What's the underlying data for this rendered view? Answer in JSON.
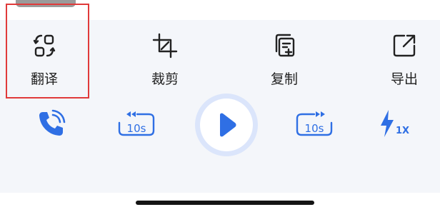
{
  "toolbar": {
    "items": [
      {
        "label": "翻译",
        "icon": "translate-icon",
        "selected": true
      },
      {
        "label": "裁剪",
        "icon": "crop-icon"
      },
      {
        "label": "复制",
        "icon": "copy-icon"
      },
      {
        "label": "导出",
        "icon": "export-icon"
      }
    ]
  },
  "player": {
    "rewind_label": "10s",
    "forward_label": "10s",
    "speed_label": "1X",
    "state": "paused"
  },
  "colors": {
    "accent": "#2f6fe4",
    "panel_bg": "#f4f6fa",
    "highlight_border": "#e03a3a",
    "text": "#222222"
  }
}
